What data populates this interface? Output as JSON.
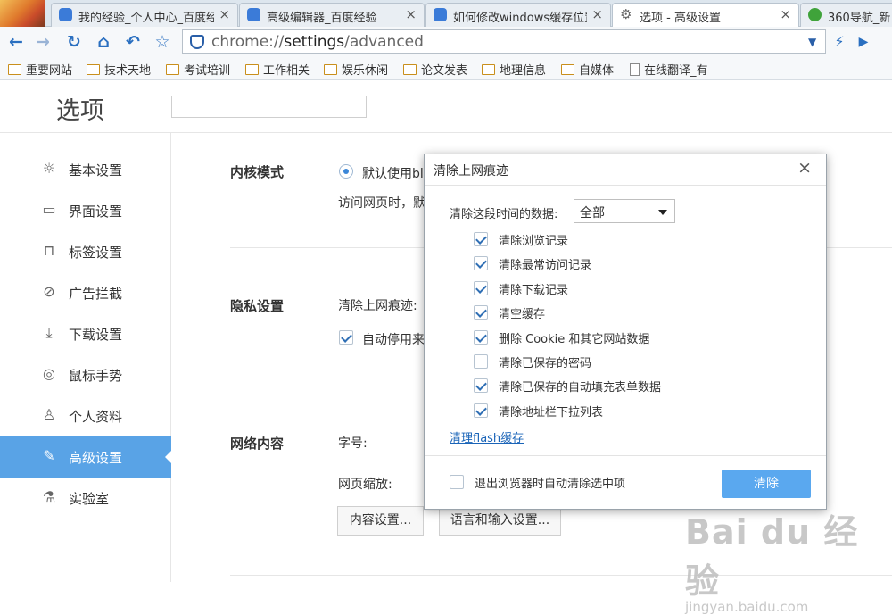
{
  "tabs": [
    {
      "title": "我的经验_个人中心_百度经",
      "icon": "baidu-paw-icon"
    },
    {
      "title": "高级编辑器_百度经验",
      "icon": "baidu-paw-icon"
    },
    {
      "title": "如何修改windows缓存位置",
      "icon": "baidu-paw-icon"
    },
    {
      "title": "选项 - 高级设置",
      "icon": "gear-icon"
    },
    {
      "title": "360导航_新",
      "icon": "360-icon"
    }
  ],
  "tab_close_glyph": "×",
  "address": {
    "scheme": "chrome://",
    "host": "settings",
    "path": "/advanced"
  },
  "bookmarks": [
    {
      "label": "重要网站",
      "icon": "folder-icon"
    },
    {
      "label": "技术天地",
      "icon": "folder-icon"
    },
    {
      "label": "考试培训",
      "icon": "folder-icon"
    },
    {
      "label": "工作相关",
      "icon": "folder-icon"
    },
    {
      "label": "娱乐休闲",
      "icon": "folder-icon"
    },
    {
      "label": "论文发表",
      "icon": "folder-icon"
    },
    {
      "label": "地理信息",
      "icon": "folder-icon"
    },
    {
      "label": "自媒体",
      "icon": "folder-icon"
    },
    {
      "label": "在线翻译_有",
      "icon": "page-icon"
    }
  ],
  "settings": {
    "title": "选项"
  },
  "sidebar": [
    {
      "label": "基本设置",
      "icon": "sun-gear-icon"
    },
    {
      "label": "界面设置",
      "icon": "window-icon"
    },
    {
      "label": "标签设置",
      "icon": "tab-icon"
    },
    {
      "label": "广告拦截",
      "icon": "block-icon"
    },
    {
      "label": "下载设置",
      "icon": "download-icon"
    },
    {
      "label": "鼠标手势",
      "icon": "mouse-icon"
    },
    {
      "label": "个人资料",
      "icon": "person-icon"
    },
    {
      "label": "高级设置",
      "icon": "wrench-icon",
      "active": true
    },
    {
      "label": "实验室",
      "icon": "flask-icon"
    }
  ],
  "main": {
    "kernel": {
      "title": "内核模式",
      "radio_label": "默认使用bl",
      "desc": "访问网页时，默"
    },
    "privacy": {
      "title": "隐私设置",
      "clear_label": "清除上网痕迹:",
      "auto_label": "自动停用来"
    },
    "web": {
      "title": "网络内容",
      "font_label": "字号:",
      "zoom_label": "网页缩放:",
      "content_btn": "内容设置...",
      "lang_btn": "语言和输入设置..."
    }
  },
  "dialog": {
    "title": "清除上网痕迹",
    "close_glyph": "×",
    "range_label": "清除这段时间的数据:",
    "range_value": "全部",
    "options": [
      {
        "label": "清除浏览记录",
        "checked": true
      },
      {
        "label": "清除最常访问记录",
        "checked": true
      },
      {
        "label": "清除下载记录",
        "checked": true
      },
      {
        "label": "清空缓存",
        "checked": true
      },
      {
        "label": "删除 Cookie 和其它网站数据",
        "checked": true
      },
      {
        "label": "清除已保存的密码",
        "checked": false
      },
      {
        "label": "清除已保存的自动填充表单数据",
        "checked": true
      },
      {
        "label": "清除地址栏下拉列表",
        "checked": true
      }
    ],
    "flash_link": "清理flash缓存",
    "exit_option": {
      "label": "退出浏览器时自动清除选中项",
      "checked": false
    },
    "clear_button": "清除"
  },
  "watermark": {
    "line1": "Bai du 经验",
    "line2": "jingyan.baidu.com"
  },
  "colors": {
    "accent": "#59a3e6",
    "link": "#1a64b8",
    "primary_button": "#5aa8ef"
  }
}
